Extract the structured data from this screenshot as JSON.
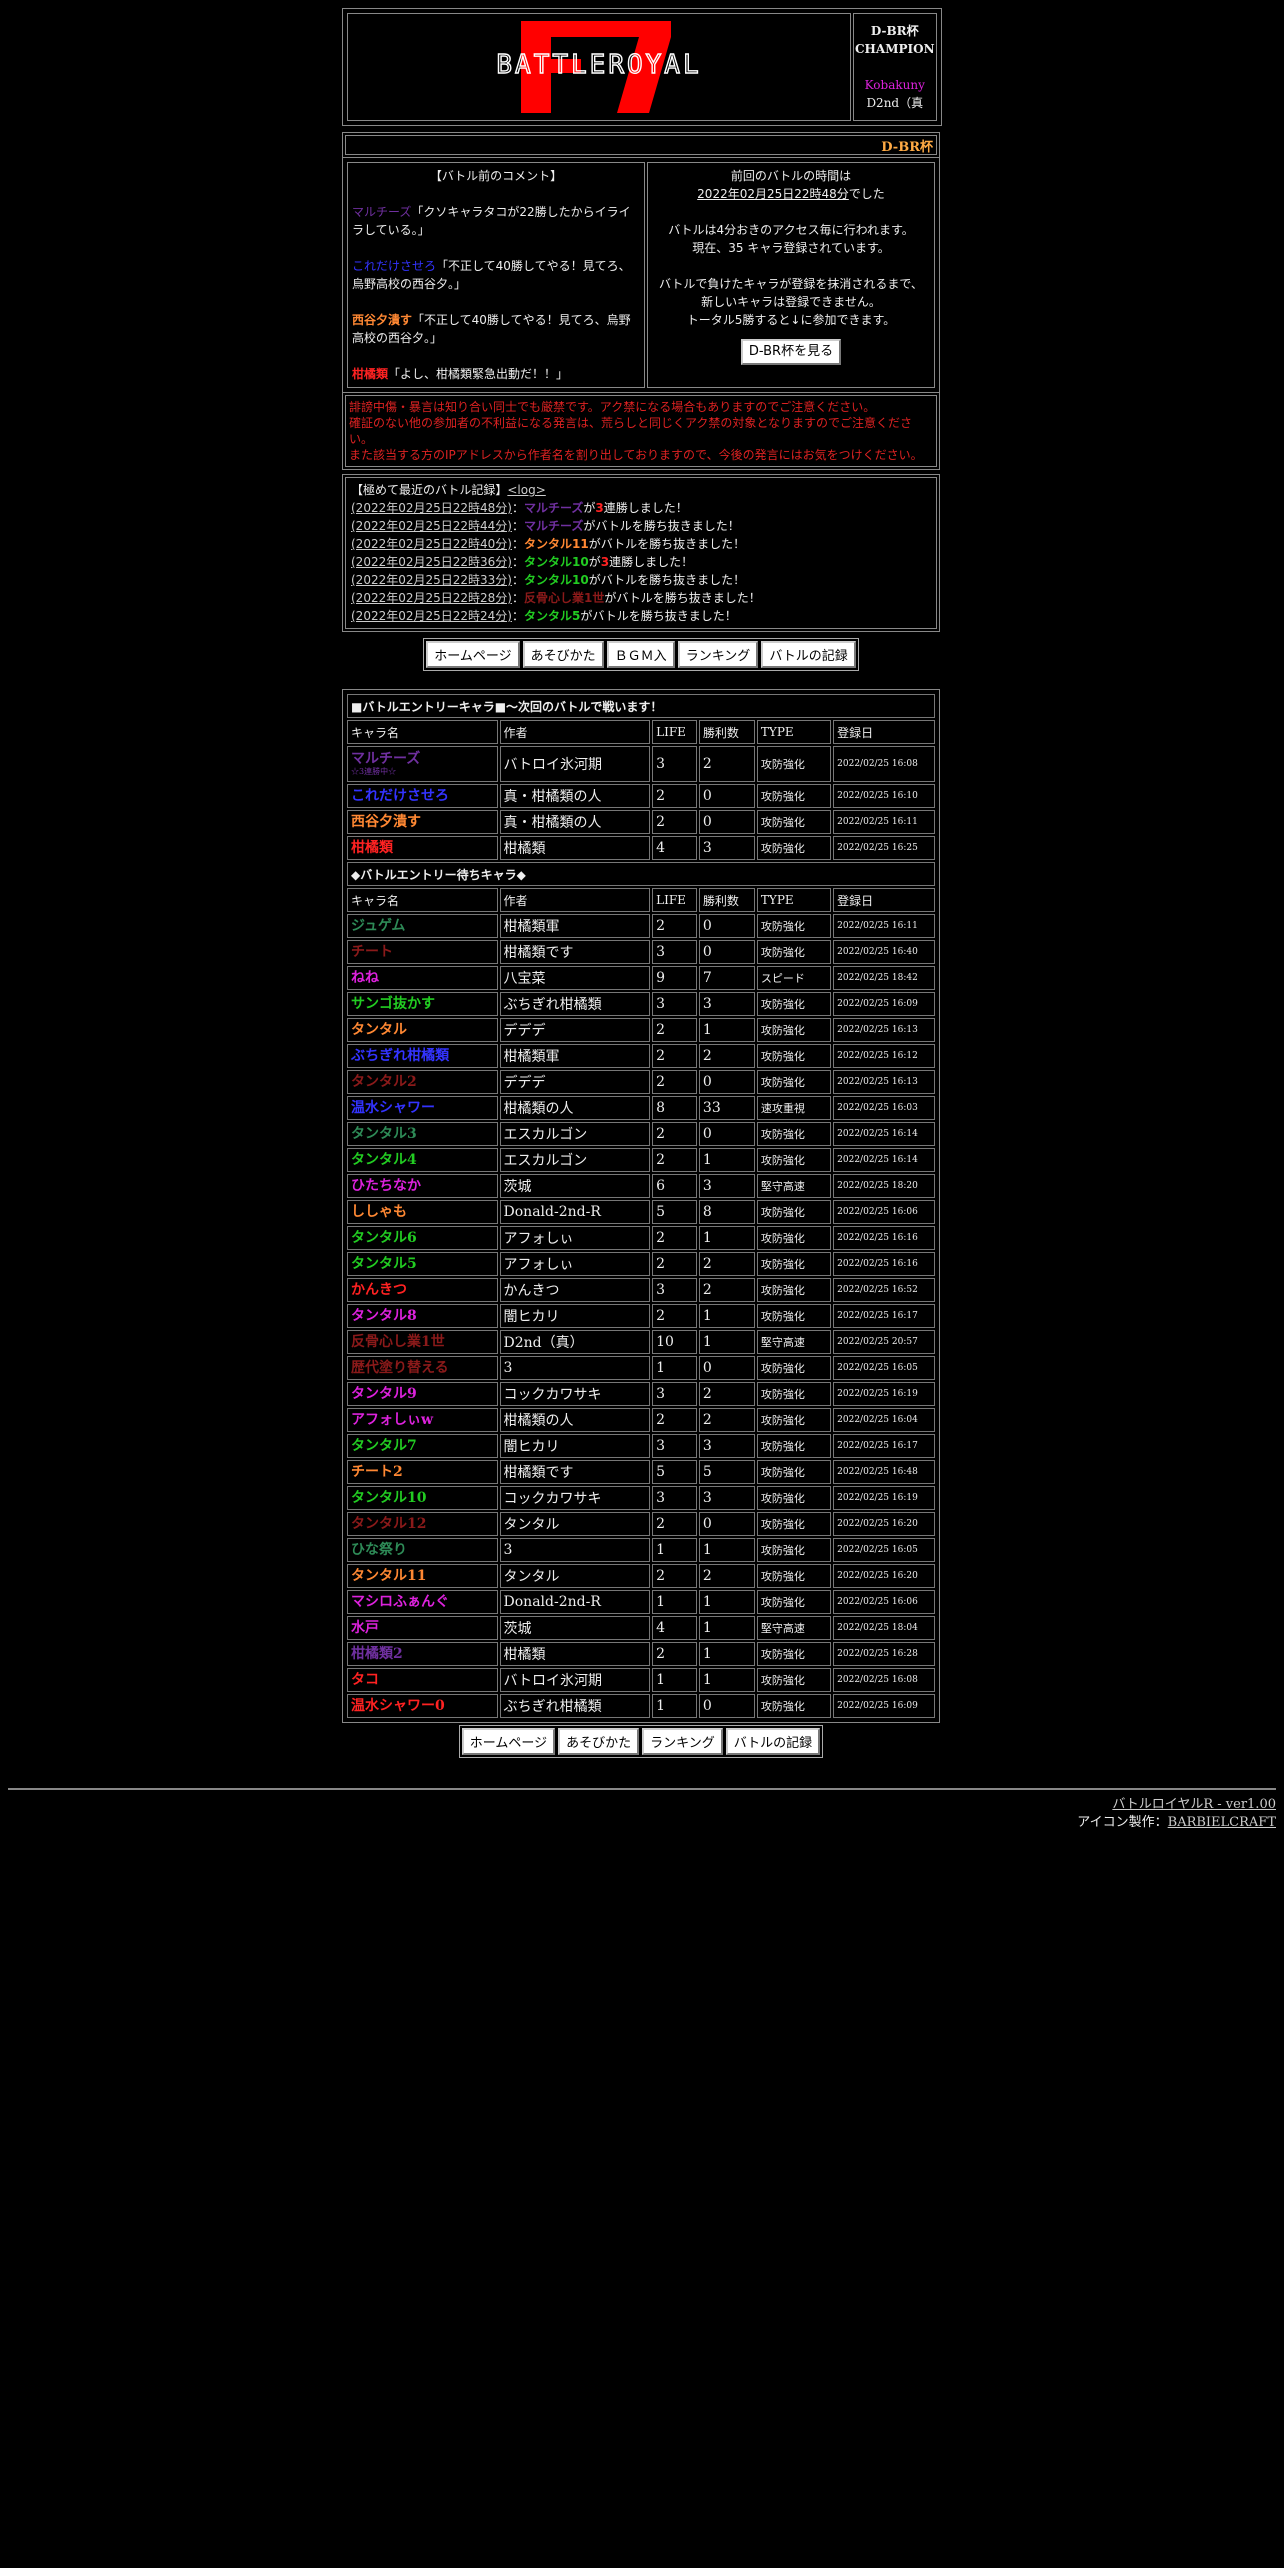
{
  "header": {
    "champ_title1": "D-BR杯",
    "champ_title2": "CHAMPION",
    "champ_name": "Kobakuny",
    "champ_sub": "D2nd（真",
    "logo_text": "BATTLEROYAL",
    "banner": "D-BR杯"
  },
  "comments": {
    "title": "【バトル前のコメント】",
    "items": [
      {
        "name": "マルチーズ",
        "color": "#7030a0",
        "text": "「クソキャラタコが22勝したからイライラしている。」"
      },
      {
        "name": "これだけさせろ",
        "color": "#3333ff",
        "text": "「不正して40勝してやる！見てろ、烏野高校の西谷夕。」"
      },
      {
        "name": "西谷夕潰す",
        "color": "#ff8833",
        "text": "「不正して40勝してやる！見てろ、烏野高校の西谷夕。」"
      },
      {
        "name": "柑橘類",
        "color": "#ff2222",
        "text": "「よし、柑橘類緊急出動だ！！」"
      }
    ]
  },
  "info": {
    "line1": "前回のバトルの時間は",
    "time": "2022年02月25日22時48分",
    "line1b": "でした",
    "line2": "バトルは4分おきのアクセス毎に行われます。",
    "line3": "現在、35 キャラ登録されています。",
    "line4": "バトルで負けたキャラが登録を抹消されるまで、",
    "line5": "新しいキャラは登録できません。",
    "line6": "トータル5勝すると↓に参加できます。",
    "button": "D-BR杯を見る"
  },
  "warning": {
    "line1": "誹謗中傷・暴言は知り合い同士でも厳禁です。アク禁になる場合もありますのでご注意ください。",
    "line2": "確証のない他の参加者の不利益になる発言は、荒らしと同じくアク禁の対象となりますのでご注意ください。",
    "line3": "また該当する方のIPアドレスから作者名を割り出しておりますので、今後の発言にはお気をつけください。"
  },
  "log": {
    "title": "【極めて最近のバトル記録】",
    "link": "<log>",
    "items": [
      {
        "time": "(2022年02月25日22時48分)",
        "name": "マルチーズ",
        "color": "#7030a0",
        "pre": "が",
        "num": "3",
        "post": "連勝しました！"
      },
      {
        "time": "(2022年02月25日22時44分)",
        "name": "マルチーズ",
        "color": "#7030a0",
        "pre": "がバトルを勝ち抜きました！",
        "num": "",
        "post": ""
      },
      {
        "time": "(2022年02月25日22時40分)",
        "name": "タンタル11",
        "color": "#ff8833",
        "pre": "がバトルを勝ち抜きました！",
        "num": "",
        "post": ""
      },
      {
        "time": "(2022年02月25日22時36分)",
        "name": "タンタル10",
        "color": "#22cc22",
        "pre": "が",
        "num": "3",
        "post": "連勝しました！"
      },
      {
        "time": "(2022年02月25日22時33分)",
        "name": "タンタル10",
        "color": "#22cc22",
        "pre": "がバトルを勝ち抜きました！",
        "num": "",
        "post": ""
      },
      {
        "time": "(2022年02月25日22時28分)",
        "name": "反骨心し業1世",
        "color": "#8b1a1a",
        "pre": "がバトルを勝ち抜きました！",
        "num": "",
        "post": ""
      },
      {
        "time": "(2022年02月25日22時24分)",
        "name": "タンタル5",
        "color": "#22cc22",
        "pre": "がバトルを勝ち抜きました！",
        "num": "",
        "post": ""
      }
    ]
  },
  "nav1": [
    "ホームページ",
    "あそびかた",
    "ＢＧＭ入",
    "ランキング",
    "バトルの記録"
  ],
  "nav2": [
    "ホームページ",
    "あそびかた",
    "ランキング",
    "バトルの記録"
  ],
  "entry": {
    "title": "■バトルエントリーキャラ■～次回のバトルで戦います！",
    "headers": [
      "キャラ名",
      "作者",
      "LIFE",
      "勝利数",
      "TYPE",
      "登録日"
    ],
    "rows": [
      {
        "name": "マルチーズ",
        "color": "#7030a0",
        "sub": "☆3連勝中☆",
        "author": "バトロイ氷河期",
        "life": "3",
        "wins": "2",
        "type": "攻防強化",
        "date": "2022/02/25 16:08"
      },
      {
        "name": "これだけさせろ",
        "color": "#3333ff",
        "author": "真・柑橘類の人",
        "life": "2",
        "wins": "0",
        "type": "攻防強化",
        "date": "2022/02/25 16:10"
      },
      {
        "name": "西谷夕潰す",
        "color": "#ff8833",
        "author": "真・柑橘類の人",
        "life": "2",
        "wins": "0",
        "type": "攻防強化",
        "date": "2022/02/25 16:11"
      },
      {
        "name": "柑橘類",
        "color": "#ff2222",
        "author": "柑橘類",
        "life": "4",
        "wins": "3",
        "type": "攻防強化",
        "date": "2022/02/25 16:25"
      }
    ]
  },
  "waiting": {
    "title": "◆バトルエントリー待ちキャラ◆",
    "headers": [
      "キャラ名",
      "作者",
      "LIFE",
      "勝利数",
      "TYPE",
      "登録日"
    ],
    "rows": [
      {
        "name": "ジュゲム",
        "color": "#2e8b57",
        "author": "柑橘類軍",
        "life": "2",
        "wins": "0",
        "type": "攻防強化",
        "date": "2022/02/25 16:11"
      },
      {
        "name": "チート",
        "color": "#8b1a1a",
        "author": "柑橘類です",
        "life": "3",
        "wins": "0",
        "type": "攻防強化",
        "date": "2022/02/25 16:40"
      },
      {
        "name": "ねね",
        "color": "#dd22dd",
        "author": "八宝菜",
        "life": "9",
        "wins": "7",
        "type": "スピード",
        "date": "2022/02/25 18:42"
      },
      {
        "name": "サンゴ抜かす",
        "color": "#22cc22",
        "author": "ぶちぎれ柑橘類",
        "life": "3",
        "wins": "3",
        "type": "攻防強化",
        "date": "2022/02/25 16:09"
      },
      {
        "name": "タンタル",
        "color": "#ff8833",
        "author": "デデデ",
        "life": "2",
        "wins": "1",
        "type": "攻防強化",
        "date": "2022/02/25 16:13"
      },
      {
        "name": "ぶちぎれ柑橘類",
        "color": "#3333ff",
        "author": "柑橘類軍",
        "life": "2",
        "wins": "2",
        "type": "攻防強化",
        "date": "2022/02/25 16:12"
      },
      {
        "name": "タンタル2",
        "color": "#8b1a1a",
        "author": "デデデ",
        "life": "2",
        "wins": "0",
        "type": "攻防強化",
        "date": "2022/02/25 16:13"
      },
      {
        "name": "温水シャワー",
        "color": "#3333ff",
        "author": "柑橘類の人",
        "life": "8",
        "wins": "33",
        "type": "速攻重視",
        "date": "2022/02/25 16:03"
      },
      {
        "name": "タンタル3",
        "color": "#2e8b57",
        "author": "エスカルゴン",
        "life": "2",
        "wins": "0",
        "type": "攻防強化",
        "date": "2022/02/25 16:14"
      },
      {
        "name": "タンタル4",
        "color": "#22cc22",
        "author": "エスカルゴン",
        "life": "2",
        "wins": "1",
        "type": "攻防強化",
        "date": "2022/02/25 16:14"
      },
      {
        "name": "ひたちなか",
        "color": "#dd22dd",
        "author": "茨城",
        "life": "6",
        "wins": "3",
        "type": "堅守高速",
        "date": "2022/02/25 18:20"
      },
      {
        "name": "ししゃも",
        "color": "#ff8833",
        "author": "Donald-2nd-R",
        "life": "5",
        "wins": "8",
        "type": "攻防強化",
        "date": "2022/02/25 16:06"
      },
      {
        "name": "タンタル6",
        "color": "#22cc22",
        "author": "アフォしぃ",
        "life": "2",
        "wins": "1",
        "type": "攻防強化",
        "date": "2022/02/25 16:16"
      },
      {
        "name": "タンタル5",
        "color": "#22cc22",
        "author": "アフォしぃ",
        "life": "2",
        "wins": "2",
        "type": "攻防強化",
        "date": "2022/02/25 16:16"
      },
      {
        "name": "かんきつ",
        "color": "#ff2222",
        "author": "かんきつ",
        "life": "3",
        "wins": "2",
        "type": "攻防強化",
        "date": "2022/02/25 16:52"
      },
      {
        "name": "タンタル8",
        "color": "#dd22dd",
        "author": "闇ヒカリ",
        "life": "2",
        "wins": "1",
        "type": "攻防強化",
        "date": "2022/02/25 16:17"
      },
      {
        "name": "反骨心し業1世",
        "color": "#8b1a1a",
        "author": "D2nd（真）",
        "life": "10",
        "wins": "1",
        "type": "堅守高速",
        "date": "2022/02/25 20:57"
      },
      {
        "name": "歴代塗り替える",
        "color": "#8b1a1a",
        "author": "3",
        "life": "1",
        "wins": "0",
        "type": "攻防強化",
        "date": "2022/02/25 16:05"
      },
      {
        "name": "タンタル9",
        "color": "#dd22dd",
        "author": "コックカワサキ",
        "life": "3",
        "wins": "2",
        "type": "攻防強化",
        "date": "2022/02/25 16:19"
      },
      {
        "name": "アフォしぃw",
        "color": "#dd22dd",
        "author": "柑橘類の人",
        "life": "2",
        "wins": "2",
        "type": "攻防強化",
        "date": "2022/02/25 16:04"
      },
      {
        "name": "タンタル7",
        "color": "#22cc22",
        "author": "闇ヒカリ",
        "life": "3",
        "wins": "3",
        "type": "攻防強化",
        "date": "2022/02/25 16:17"
      },
      {
        "name": "チート2",
        "color": "#ff8833",
        "author": "柑橘類です",
        "life": "5",
        "wins": "5",
        "type": "攻防強化",
        "date": "2022/02/25 16:48"
      },
      {
        "name": "タンタル10",
        "color": "#22cc22",
        "author": "コックカワサキ",
        "life": "3",
        "wins": "3",
        "type": "攻防強化",
        "date": "2022/02/25 16:19"
      },
      {
        "name": "タンタル12",
        "color": "#8b1a1a",
        "author": "タンタル",
        "life": "2",
        "wins": "0",
        "type": "攻防強化",
        "date": "2022/02/25 16:20"
      },
      {
        "name": "ひな祭り",
        "color": "#2e8b57",
        "author": "3",
        "life": "1",
        "wins": "1",
        "type": "攻防強化",
        "date": "2022/02/25 16:05"
      },
      {
        "name": "タンタル11",
        "color": "#ff8833",
        "author": "タンタル",
        "life": "2",
        "wins": "2",
        "type": "攻防強化",
        "date": "2022/02/25 16:20"
      },
      {
        "name": "マシロふぁんぐ",
        "color": "#dd22dd",
        "author": "Donald-2nd-R",
        "life": "1",
        "wins": "1",
        "type": "攻防強化",
        "date": "2022/02/25 16:06"
      },
      {
        "name": "水戸",
        "color": "#dd22dd",
        "author": "茨城",
        "life": "4",
        "wins": "1",
        "type": "堅守高速",
        "date": "2022/02/25 18:04"
      },
      {
        "name": "柑橘類2",
        "color": "#7030a0",
        "author": "柑橘類",
        "life": "2",
        "wins": "1",
        "type": "攻防強化",
        "date": "2022/02/25 16:28"
      },
      {
        "name": "タコ",
        "color": "#ff2222",
        "author": "バトロイ氷河期",
        "life": "1",
        "wins": "1",
        "type": "攻防強化",
        "date": "2022/02/25 16:08"
      },
      {
        "name": "温水シャワー0",
        "color": "#ff2222",
        "author": "ぶちぎれ柑橘類",
        "life": "1",
        "wins": "0",
        "type": "攻防強化",
        "date": "2022/02/25 16:09"
      }
    ]
  },
  "footer": {
    "version": "バトルロイヤルR - ver1.00",
    "credit_label": "アイコン製作：",
    "credit_link": "BARBIELCRAFT"
  },
  "colors": {
    "accent": "#ff0000",
    "banner": "#ffaa44",
    "warning": "#dd2222",
    "champ_name": "#dd22dd"
  }
}
